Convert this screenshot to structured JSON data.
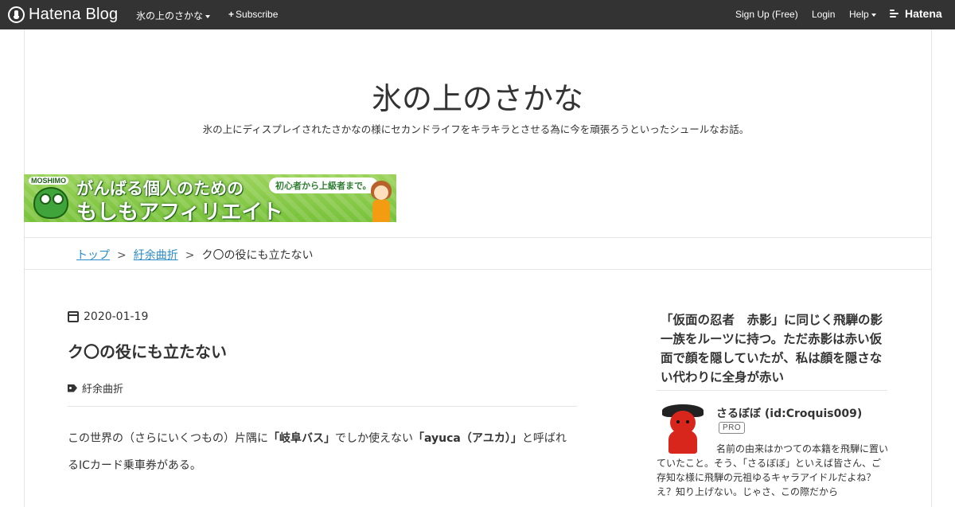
{
  "topbar": {
    "logo_text": "Hatena Blog",
    "blog_menu": "氷の上のさかな",
    "subscribe": "Subscribe",
    "signup": "Sign Up (Free)",
    "login": "Login",
    "help": "Help",
    "hatena": "Hatena"
  },
  "blog": {
    "title": "氷の上のさかな",
    "description": "氷の上にディスプレイされたさかなの様にセカンドライフをキラキラとさせる為に今を頑張ろうといったシュールなお話。"
  },
  "banner": {
    "brand": "MOSHIMO",
    "line1": "がんばる個人のための",
    "line2": "もしもアフィリエイト",
    "bubble": "初心者から上級者まで。",
    "colors": {
      "background": "#8cca4c",
      "text_outline": "#1d5f16"
    }
  },
  "breadcrumb": {
    "top": "トップ",
    "separator": ">",
    "category": "紆余曲折",
    "current": "ク〇の役にも立たない"
  },
  "entry": {
    "date": "2020-01-19",
    "title": "ク〇の役にも立たない",
    "category": "紆余曲折",
    "body": {
      "part1": "この世界の（さらにいくつもの）片隅に",
      "bold1": "「岐阜バス」",
      "part2": "でしか使えない",
      "bold2": "「ayuca（アユカ）」",
      "part3": "と呼ばれるICカード乗車券がある。"
    }
  },
  "sidebar": {
    "lead": "「仮面の忍者　赤影」に同じく飛騨の影一族をルーツに持つ。ただ赤影は赤い仮面で顔を隠していたが、私は顔を隠さない代わりに全身が赤い",
    "profile_name": "さるぼぼ (id:Croquis009)",
    "badge": "PRO",
    "profile_desc": "名前の由来はかつての本籍を飛騨に置いていたこと。そう、「さるぼぼ」といえば皆さん、ご存知な様に飛騨の元祖ゆるキャラアイドルだよね？え？知り上げない。じゃさ、この際だから"
  },
  "colors": {
    "topbar_bg": "#333333",
    "link": "#2a8cc9",
    "text": "#333333",
    "border": "#e5e5e5"
  }
}
